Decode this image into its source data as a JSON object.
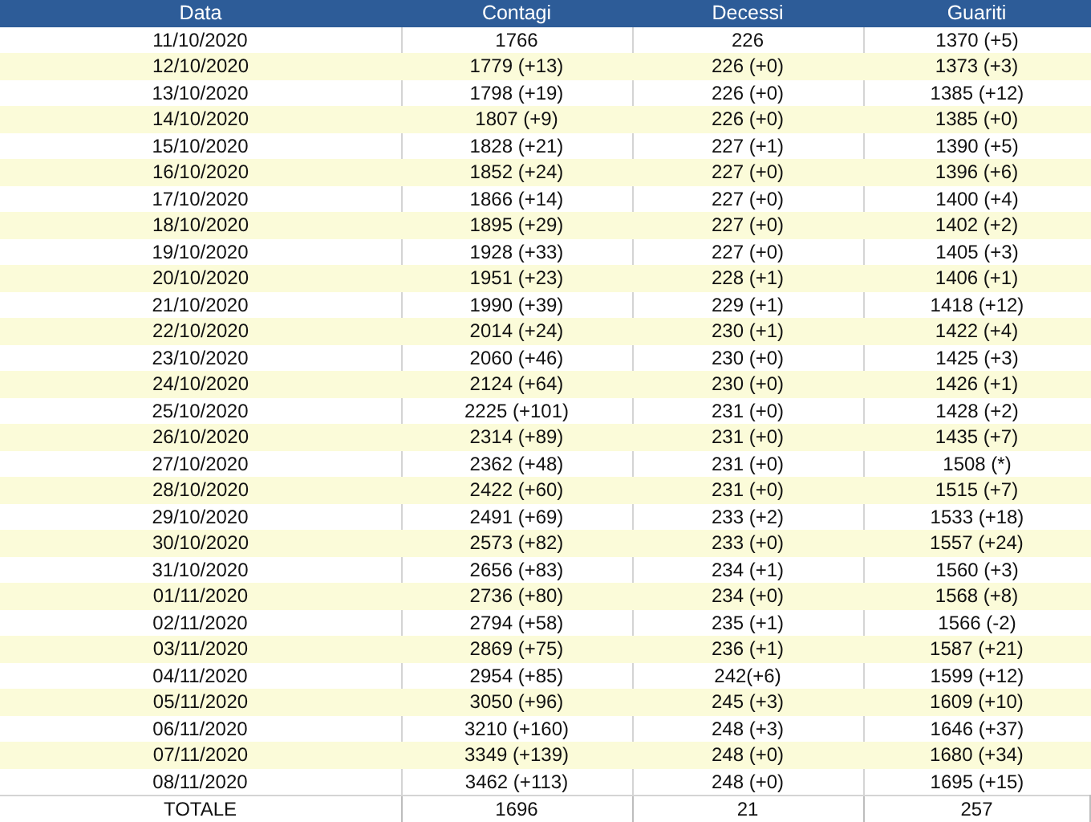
{
  "table": {
    "columns": [
      "Data",
      "Contagi",
      "Decessi",
      "Guariti"
    ],
    "rows": [
      [
        "11/10/2020",
        "1766",
        "226",
        "1370 (+5)"
      ],
      [
        "12/10/2020",
        "1779 (+13)",
        "226 (+0)",
        "1373 (+3)"
      ],
      [
        "13/10/2020",
        "1798 (+19)",
        "226 (+0)",
        "1385 (+12)"
      ],
      [
        "14/10/2020",
        "1807 (+9)",
        "226 (+0)",
        "1385 (+0)"
      ],
      [
        "15/10/2020",
        "1828 (+21)",
        "227 (+1)",
        "1390 (+5)"
      ],
      [
        "16/10/2020",
        "1852 (+24)",
        "227 (+0)",
        "1396 (+6)"
      ],
      [
        "17/10/2020",
        "1866 (+14)",
        "227 (+0)",
        "1400 (+4)"
      ],
      [
        "18/10/2020",
        "1895 (+29)",
        "227 (+0)",
        "1402 (+2)"
      ],
      [
        "19/10/2020",
        "1928 (+33)",
        "227 (+0)",
        "1405 (+3)"
      ],
      [
        "20/10/2020",
        "1951 (+23)",
        "228 (+1)",
        "1406 (+1)"
      ],
      [
        "21/10/2020",
        "1990 (+39)",
        "229 (+1)",
        "1418 (+12)"
      ],
      [
        "22/10/2020",
        "2014 (+24)",
        "230 (+1)",
        "1422 (+4)"
      ],
      [
        "23/10/2020",
        "2060 (+46)",
        "230 (+0)",
        "1425 (+3)"
      ],
      [
        "24/10/2020",
        "2124 (+64)",
        "230 (+0)",
        "1426 (+1)"
      ],
      [
        "25/10/2020",
        "2225 (+101)",
        "231 (+0)",
        "1428 (+2)"
      ],
      [
        "26/10/2020",
        "2314 (+89)",
        "231 (+0)",
        "1435 (+7)"
      ],
      [
        "27/10/2020",
        "2362 (+48)",
        "231 (+0)",
        "1508 (*)"
      ],
      [
        "28/10/2020",
        "2422 (+60)",
        "231 (+0)",
        "1515 (+7)"
      ],
      [
        "29/10/2020",
        "2491 (+69)",
        "233 (+2)",
        "1533 (+18)"
      ],
      [
        "30/10/2020",
        "2573 (+82)",
        "233 (+0)",
        "1557 (+24)"
      ],
      [
        "31/10/2020",
        "2656 (+83)",
        "234 (+1)",
        "1560 (+3)"
      ],
      [
        "01/11/2020",
        "2736 (+80)",
        "234 (+0)",
        "1568 (+8)"
      ],
      [
        "02/11/2020",
        "2794 (+58)",
        "235 (+1)",
        "1566 (-2)"
      ],
      [
        "03/11/2020",
        "2869 (+75)",
        "236 (+1)",
        "1587 (+21)"
      ],
      [
        "04/11/2020",
        "2954 (+85)",
        "242(+6)",
        "1599 (+12)"
      ],
      [
        "05/11/2020",
        "3050 (+96)",
        "245 (+3)",
        "1609 (+10)"
      ],
      [
        "06/11/2020",
        "3210 (+160)",
        "248 (+3)",
        "1646 (+37)"
      ],
      [
        "07/11/2020",
        "3349 (+139)",
        "248 (+0)",
        "1680 (+34)"
      ],
      [
        "08/11/2020",
        "3462 (+113)",
        "248 (+0)",
        "1695 (+15)"
      ]
    ],
    "totals": [
      "TOTALE",
      "1696",
      "21",
      "257"
    ]
  }
}
